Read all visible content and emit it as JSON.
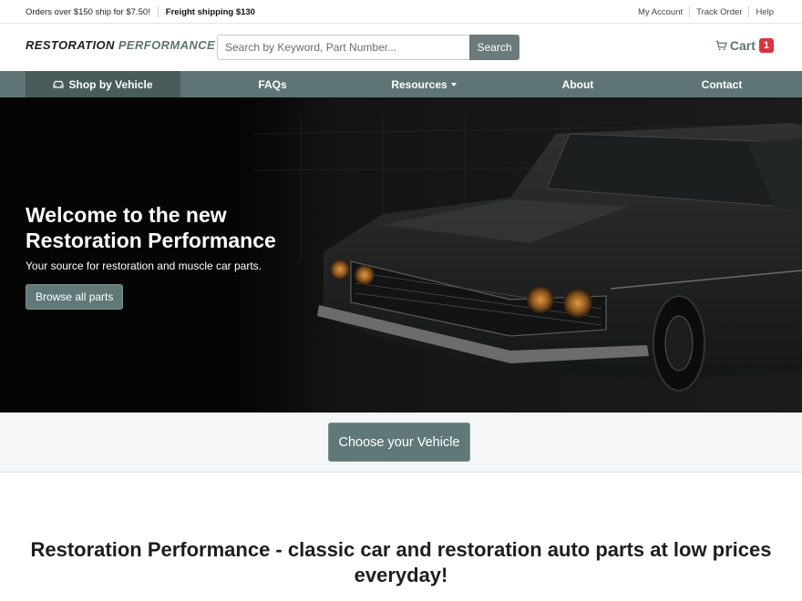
{
  "topbar": {
    "promo": "Orders over $150 ship for $7.50!",
    "freight": "Freight shipping $130",
    "links": [
      "My Account",
      "Track Order",
      "Help"
    ]
  },
  "header": {
    "logo_part1": "RESTORATION",
    "logo_part2": "PERFORMANCE",
    "search_placeholder": "Search by Keyword, Part Number...",
    "search_button": "Search",
    "cart_label": "Cart",
    "cart_count": "1"
  },
  "nav": {
    "items": [
      "Shop by Vehicle",
      "FAQs",
      "Resources",
      "About",
      "Contact"
    ],
    "active": "Shop by Vehicle"
  },
  "hero": {
    "title": "Welcome to the new Restoration Performance",
    "subtitle": "Your source for restoration and muscle car parts.",
    "button": "Browse all parts"
  },
  "vehicle_band": {
    "button": "Choose your Vehicle"
  },
  "main": {
    "heading": "Restoration Performance - classic car and restoration auto parts at low prices everyday!"
  },
  "colors": {
    "accent": "#5f7575",
    "accent_dark": "#485c5c",
    "badge": "#d9343f"
  }
}
